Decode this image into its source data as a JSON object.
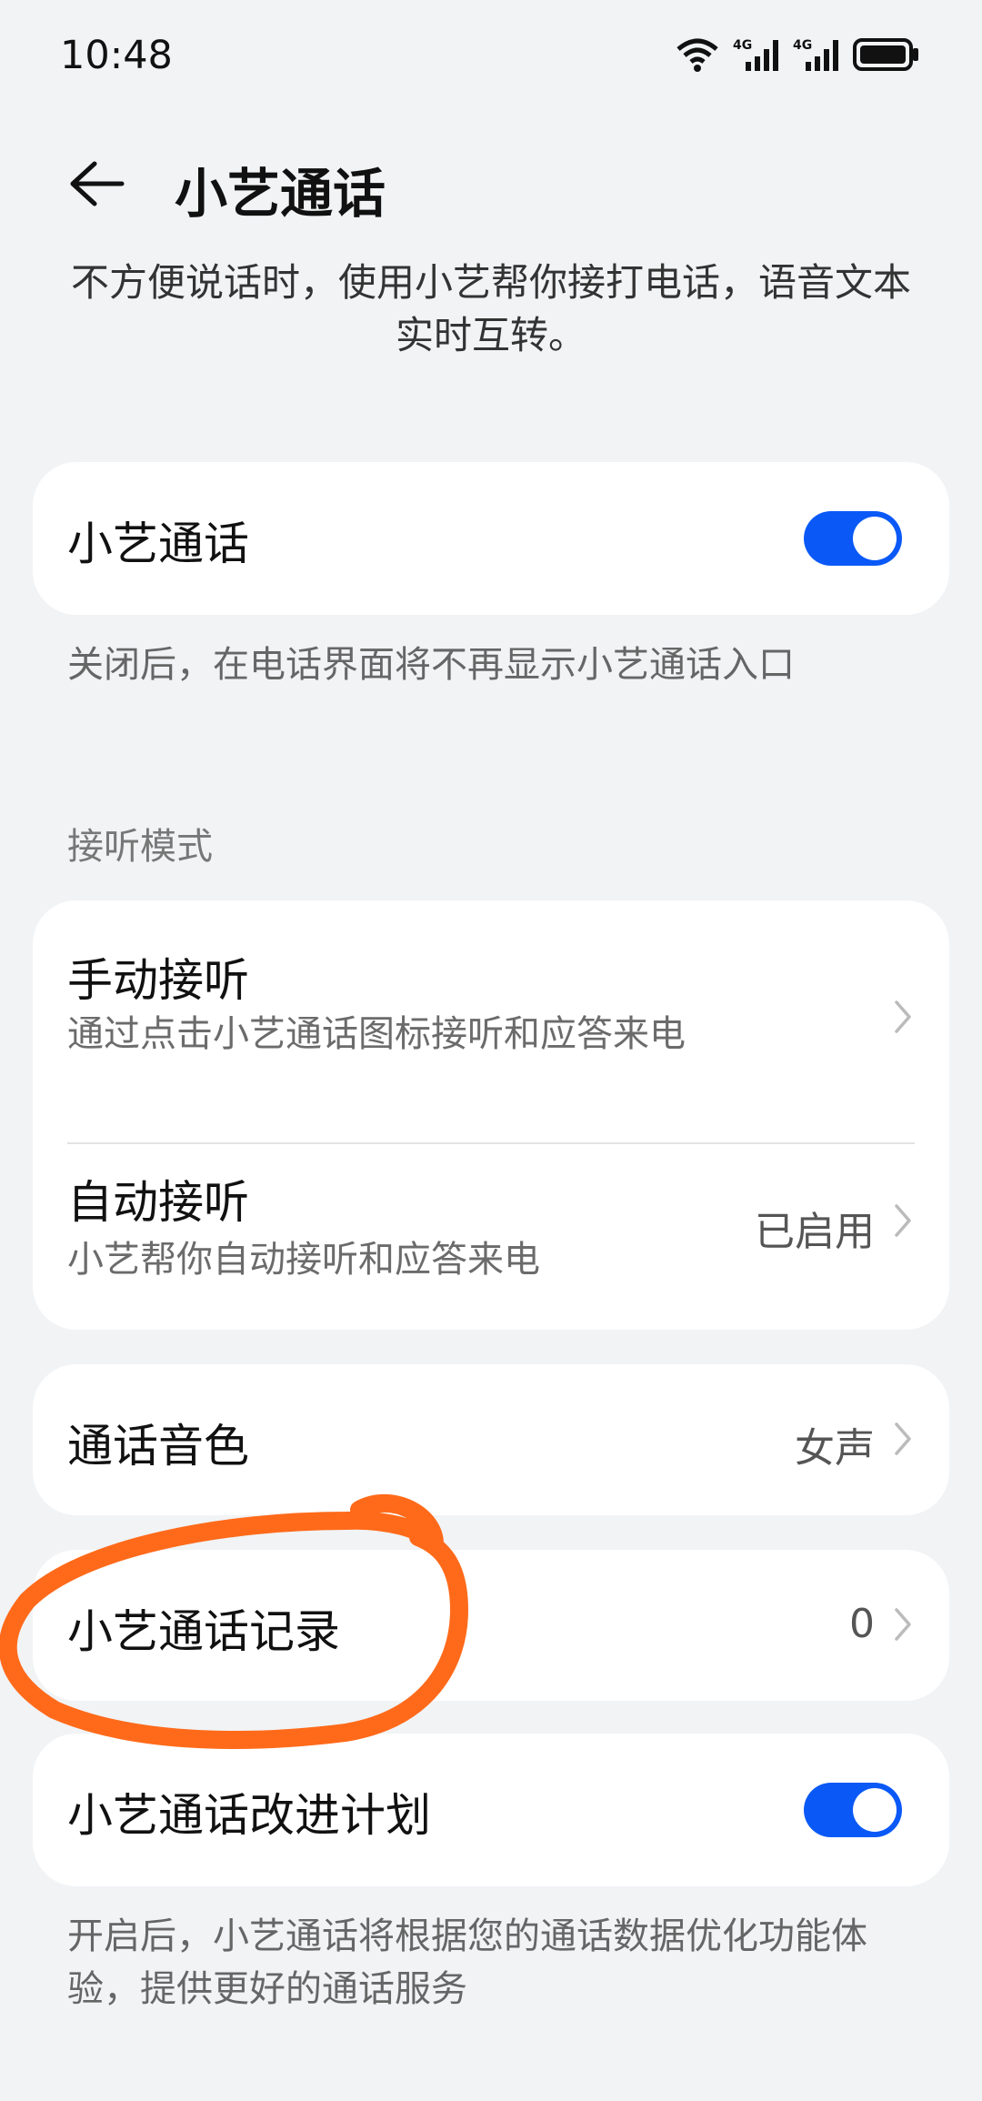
{
  "status_bar": {
    "time": "10:48",
    "network_label_1": "4G",
    "network_label_2": "4G",
    "icons": [
      "wifi-icon",
      "signal-icon",
      "signal-icon",
      "battery-icon"
    ]
  },
  "header": {
    "title": "小艺通话",
    "back_icon": "back-arrow-icon"
  },
  "intro_text": "不方便说话时，使用小艺帮你接打电话，语音文本实时互转。",
  "main_toggle": {
    "label": "小艺通话",
    "enabled": true,
    "description": "关闭后，在电话界面将不再显示小艺通话入口"
  },
  "answer_mode": {
    "section_label": "接听模式",
    "options": [
      {
        "title": "手动接听",
        "subtitle": "通过点击小艺通话图标接听和应答来电",
        "value": ""
      },
      {
        "title": "自动接听",
        "subtitle": "小艺帮你自动接听和应答来电",
        "value": "已启用"
      }
    ]
  },
  "voice": {
    "label": "通话音色",
    "value": "女声"
  },
  "records": {
    "label": "小艺通话记录",
    "value": "0"
  },
  "improvement": {
    "label": "小艺通话改进计划",
    "enabled": true,
    "description": "开启后，小艺通话将根据您的通话数据优化功能体验，提供更好的通话服务"
  },
  "colors": {
    "accent": "#0a59f7",
    "background": "#f1f3f5",
    "card": "#ffffff",
    "annotation": "#ff6a1a"
  }
}
